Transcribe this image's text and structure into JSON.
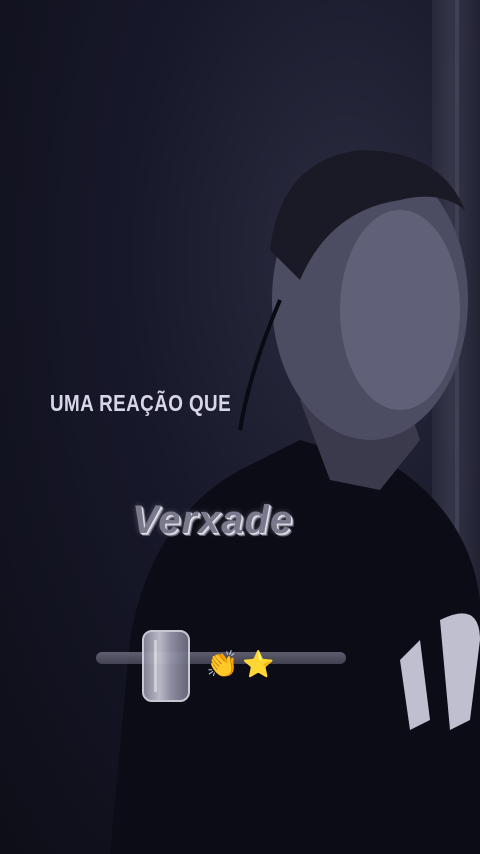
{
  "caption": {
    "text": "UMA REAÇÃO QUE"
  },
  "highlight_word": {
    "text": "Verxade"
  },
  "reaction_slider": {
    "emojis": [
      "👏",
      "⭐"
    ]
  }
}
